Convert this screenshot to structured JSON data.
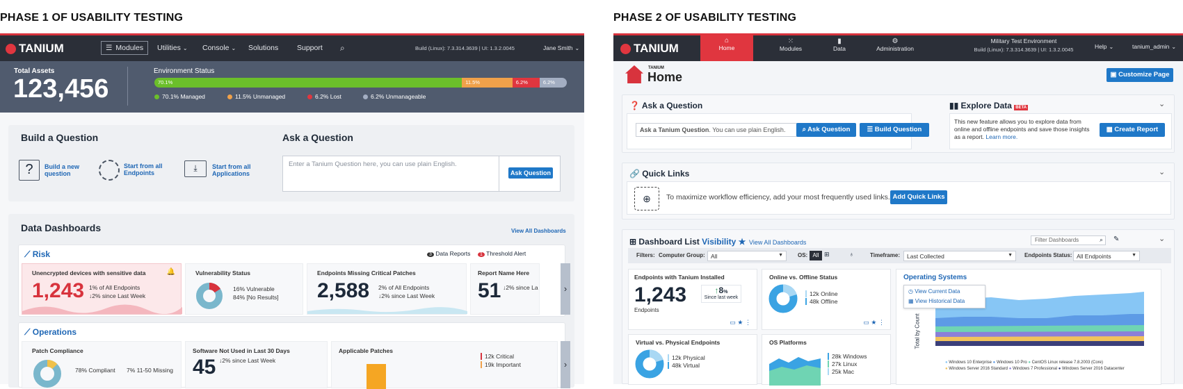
{
  "phase1": {
    "title": "PHASE 1 OF USABILITY TESTING",
    "nav": {
      "logo": "TANIUM",
      "modules": "Modules",
      "utilities": "Utilities",
      "console": "Console",
      "solutions": "Solutions",
      "support": "Support",
      "build": "Build (Linux): 7.3.314.3639 | UI: 1.3.2.0045",
      "user": "Jane Smith"
    },
    "env": {
      "assets_label": "Total Assets",
      "assets_value": "123,456",
      "status_label": "Environment Status",
      "segments": [
        {
          "label": "70.1%",
          "pct": 70.1,
          "color": "#6bbf2a"
        },
        {
          "label": "11.5%",
          "pct": 11.5,
          "color": "#f0a14a"
        },
        {
          "label": "6.2%",
          "pct": 6.2,
          "color": "#e0363f"
        },
        {
          "label": "6.2%",
          "pct": 6.2,
          "color": "#a3aec2"
        }
      ],
      "legend": [
        "70.1% Managed",
        "11.5% Unmanaged",
        "6.2% Lost",
        "6.2% Unmanageable"
      ]
    },
    "build": {
      "title": "Build a Question",
      "opt1": "Build a new question",
      "opt2": "Start from all Endpoints",
      "opt3": "Start from all Applications"
    },
    "ask": {
      "title": "Ask a Question",
      "placeholder": "Enter a Tanium Question here, you can use plain English.",
      "button": "Ask Question"
    },
    "dash": {
      "title": "Data Dashboards",
      "view_all": "View All Dashboards",
      "risk": {
        "title": "Risk",
        "data_reports": "Data Reports",
        "data_reports_count": "3",
        "threshold": "Threshold Alert",
        "threshold_count": "1",
        "c1": {
          "title": "Unencrypted devices with sensitive data",
          "value": "1,243",
          "l1": "1% of All Endpoints",
          "l2": "↓2% since Last Week"
        },
        "c2": {
          "title": "Vulnerability Status",
          "l1": "16% Vulnerable",
          "l2": "84% [No Results]"
        },
        "c3": {
          "title": "Endpoints Missing Critical Patches",
          "value": "2,588",
          "l1": "2% of All Endpoints",
          "l2": "↓2% since Last Week"
        },
        "c4": {
          "title": "Report Name Here",
          "value": "51",
          "l1": "↓2% since La"
        }
      },
      "ops": {
        "title": "Operations",
        "c1": {
          "title": "Patch Compliance",
          "l1": "78% Compliant",
          "l2": "7% 11-50 Missing"
        },
        "c2": {
          "title": "Software Not Used in Last 30 Days",
          "value": "45",
          "l1": "↓2% since Last Week"
        },
        "c3": {
          "title": "Applicable Patches",
          "l1": "12k Critical",
          "l2": "19k Important"
        }
      }
    }
  },
  "phase2": {
    "title": "PHASE 2 OF USABILITY TESTING",
    "nav": {
      "logo": "TANIUM",
      "home": "Home",
      "modules": "Modules",
      "data": "Data",
      "admin": "Administration",
      "env": "Military Test Environment",
      "build": "Build (Linux): 7.3.314.3639 | UI: 1.3.2.0045",
      "help": "Help",
      "user": "tanium_admin"
    },
    "page": {
      "brand": "TANIUM",
      "title": "Home",
      "customize": "Customize Page"
    },
    "ask": {
      "title": "Ask a Question",
      "placeholder_bold": "Ask a Tanium Question",
      "placeholder_rest": ". You can use plain English.",
      "ask_btn": "Ask Question",
      "build_btn": "Build Question"
    },
    "explore": {
      "title": "Explore Data",
      "badge": "BETA",
      "desc": "This new feature allows you to explore data from online and offline endpoints and save those insights as a report.",
      "learn": "Learn more.",
      "btn": "Create Report"
    },
    "quick": {
      "title": "Quick Links",
      "desc": "To maximize workflow efficiency, add your most frequently used links.",
      "btn": "Add Quick Links"
    },
    "dashlist": {
      "title": "Dashboard List",
      "vis": "Visibility",
      "view_all": "View All Dashboards",
      "filter_placeholder": "Filter Dashboards",
      "filters": {
        "label": "Filters:",
        "group_label": "Computer Group:",
        "group_val": "All",
        "os_label": "OS:",
        "os_all": "All",
        "time_label": "Timeframe:",
        "time_val": "Last Collected",
        "status_label": "Endpoints Status:",
        "status_val": "All Endpoints"
      },
      "c1": {
        "title": "Endpoints with Tanium Installed",
        "value": "1,243",
        "sub": "Endpoints",
        "delta": "8",
        "delta_unit": "%",
        "delta_sub": "Since last week"
      },
      "c2": {
        "title": "Online vs. Offline Status",
        "l1": "12k Online",
        "l2": "48k Offline"
      },
      "c3": {
        "title": "Operating Systems",
        "menu1": "View Current Data",
        "menu2": "View Historical Data",
        "ylabel": "Total by Count",
        "legend": [
          "Windows 10 Enterprise",
          "Windows 10 Pro",
          "CentOS Linux release 7.8.2003 (Core)",
          "Windows Server 2016 Standard",
          "Windows 7 Professional",
          "Windows Server 2016 Datacenter"
        ]
      },
      "c4": {
        "title": "Virtual vs. Physical Endpoints",
        "l1": "12k Physical",
        "l2": "48k Virtual"
      },
      "c5": {
        "title": "OS Platforms",
        "l1": "28k Windows",
        "l2": "27k Linux",
        "l3": "25k Mac"
      }
    }
  }
}
